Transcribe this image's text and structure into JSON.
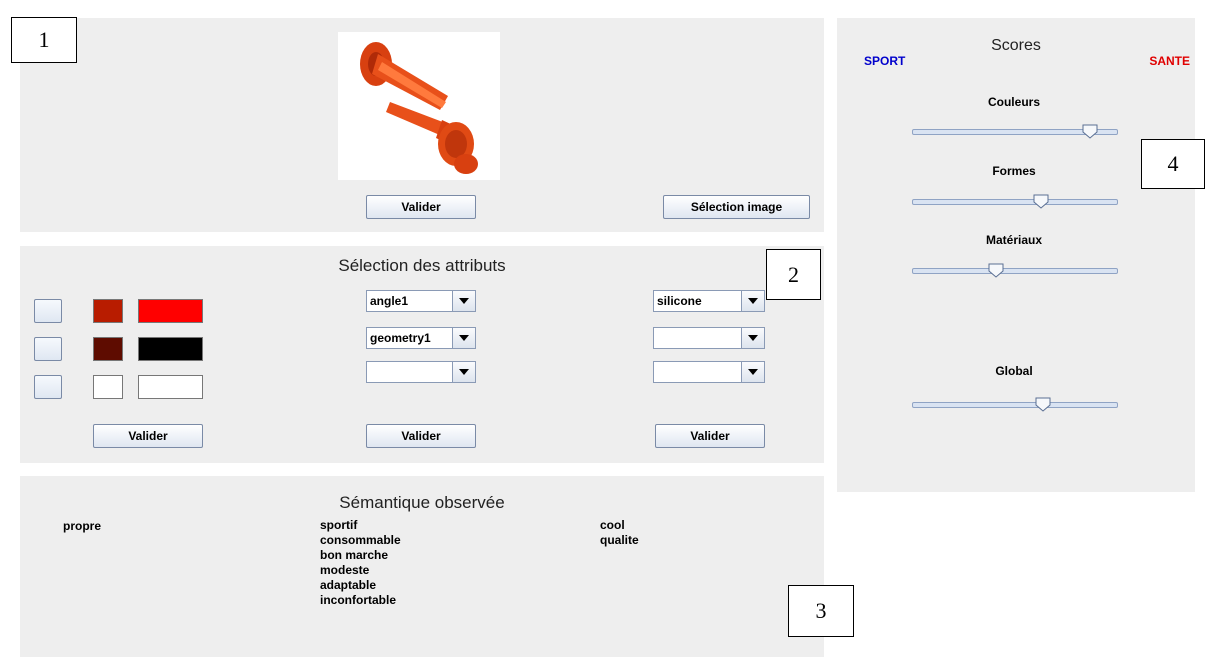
{
  "annotations": {
    "a1": "1",
    "a2": "2",
    "a3": "3",
    "a4": "4"
  },
  "image_panel": {
    "image_alt": "orange product image",
    "validate_label": "Valider",
    "select_image_label": "Sélection image"
  },
  "attributes_panel": {
    "title": "Sélection des attributs",
    "color_rows": [
      {
        "swatch_small": "#b81c00",
        "swatch_large": "#ff0000"
      },
      {
        "swatch_small": "#5e0c00",
        "swatch_large": "#000000"
      },
      {
        "swatch_small": "#ffffff",
        "swatch_large": "#ffffff"
      }
    ],
    "shape_combos": [
      "angle1",
      "geometry1",
      ""
    ],
    "material_combos": [
      "silicone",
      "",
      ""
    ],
    "validate_colors": "Valider",
    "validate_shapes": "Valider",
    "validate_materials": "Valider"
  },
  "semantics_panel": {
    "title": "Sémantique observée",
    "col1": [
      "propre"
    ],
    "col2": [
      "sportif",
      "consommable",
      "bon marche",
      "modeste",
      "adaptable",
      "inconfortable"
    ],
    "col3": [
      "cool",
      "qualite"
    ]
  },
  "scores_panel": {
    "title": "Scores",
    "left_label": "SPORT",
    "right_label": "SANTE",
    "left_color": "#0000cc",
    "right_color": "#e00000",
    "sliders": [
      {
        "label": "Couleurs",
        "value_fraction": 0.9
      },
      {
        "label": "Formes",
        "value_fraction": 0.64
      },
      {
        "label": "Matériaux",
        "value_fraction": 0.4
      },
      {
        "label": "Global",
        "value_fraction": 0.65
      }
    ]
  }
}
